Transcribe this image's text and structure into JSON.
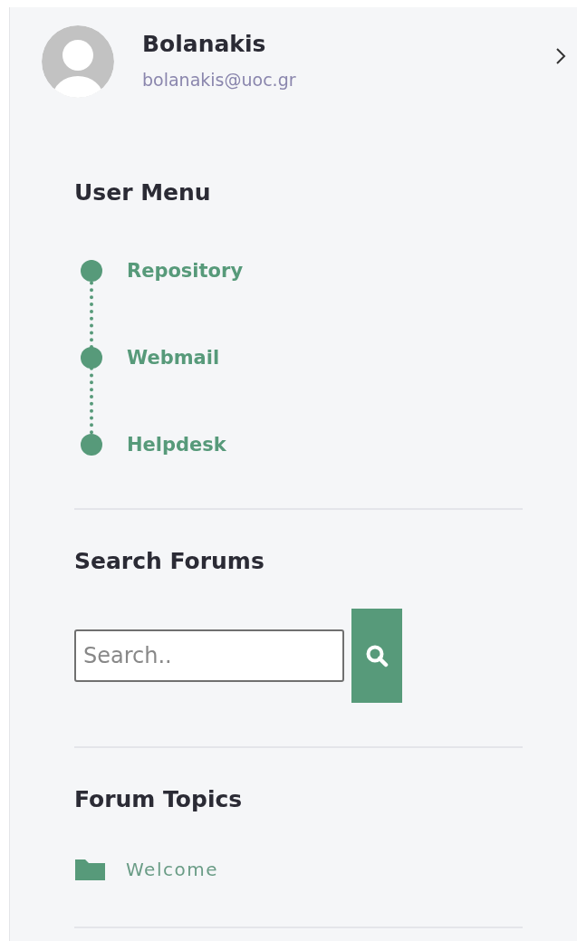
{
  "profile": {
    "name": "Bolanakis",
    "email": "bolanakis@uoc.gr"
  },
  "user_menu": {
    "title": "User Menu",
    "items": [
      {
        "label": "Repository"
      },
      {
        "label": "Webmail"
      },
      {
        "label": "Helpdesk"
      }
    ]
  },
  "search_forums": {
    "title": "Search Forums",
    "placeholder": "Search.."
  },
  "forum_topics": {
    "title": "Forum Topics",
    "items": [
      {
        "label": "Welcome"
      }
    ]
  }
}
